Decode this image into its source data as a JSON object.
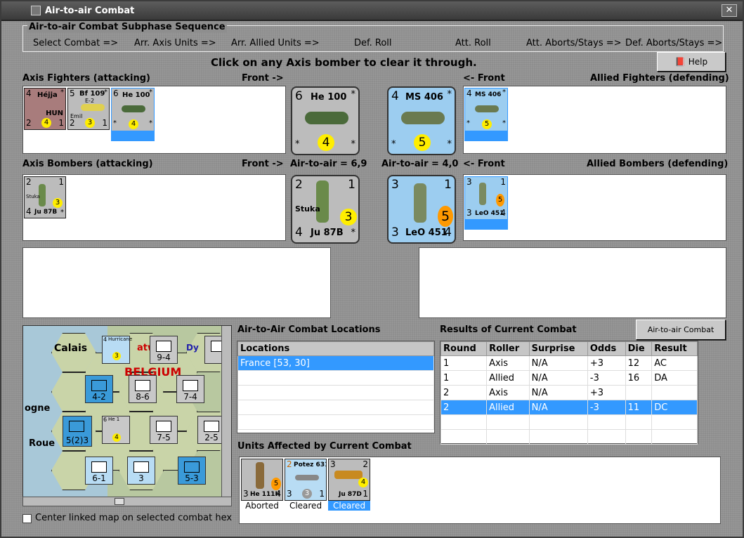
{
  "window": {
    "title": "Air-to-air Combat"
  },
  "sequence": {
    "legend": "Air-to-air Combat Subphase Sequence",
    "steps": [
      "Select Combat =>",
      "Arr. Axis Units =>",
      "Arr. Allied Units =>",
      "Def. Roll",
      "Att. Roll",
      "Att. Aborts/Stays =>",
      "Def. Aborts/Stays =>"
    ]
  },
  "instruction": "Click on any Axis bomber to clear it through.",
  "help_button": "Help",
  "labels": {
    "axis_fighters": "Axis Fighters (attacking)",
    "front_right": "Front ->",
    "front_left": "<- Front",
    "allied_fighters": "Allied Fighters (defending)",
    "axis_bombers": "Axis Bombers (attacking)",
    "air_axis": "Air-to-air = 6,9",
    "air_allied": "Air-to-air = 4,0",
    "allied_bombers": "Allied Bombers (defending)"
  },
  "axis_fighters": [
    {
      "tl": "4",
      "nm": "Héjja",
      "sub": "HUN",
      "bl": "2",
      "die": "4",
      "br": "1",
      "tr": "*",
      "color": "#a87c7c"
    },
    {
      "tl": "5",
      "nm": "Bf 109",
      "sub": "E-2",
      "note": "Emil",
      "bl": "2",
      "die": "3",
      "br": "1",
      "tr": "*",
      "color": "#bcbcbc"
    },
    {
      "tl": "6",
      "nm": "He 100",
      "bl": "*",
      "die": "4",
      "br": "*",
      "tr": "*",
      "color": "#bcbcbc"
    }
  ],
  "front_axis_fighter": {
    "tl": "6",
    "nm": "He 100",
    "tr": "*",
    "bl": "*",
    "die": "4",
    "br": "*"
  },
  "front_allied_fighter": {
    "tl": "4",
    "nm": "MS 406",
    "tr": "*",
    "bl": "*",
    "die": "5",
    "br": "*"
  },
  "allied_fighters": [
    {
      "tl": "4",
      "nm": "MS 406",
      "tr": "*",
      "bl": "*",
      "die": "5",
      "br": "*"
    }
  ],
  "axis_bombers": [
    {
      "tl": "2",
      "tr": "1",
      "note": "Stuka",
      "die": "3",
      "bl": "4",
      "nm": "Ju 87B",
      "br": "*"
    }
  ],
  "front_axis_bomber": {
    "tl": "2",
    "tr": "1",
    "note": "Stuka",
    "die": "3",
    "bl": "4",
    "nm": "Ju 87B",
    "br": "*"
  },
  "front_allied_bomber": {
    "tl": "3",
    "tr": "1",
    "die": "5",
    "bl": "3",
    "nm": "LeO 451",
    "br": "4"
  },
  "allied_bombers": [
    {
      "tl": "3",
      "tr": "1",
      "die": "5",
      "bl": "3",
      "nm": "LeO 451",
      "br": "4"
    }
  ],
  "locations": {
    "title": "Air-to-Air Combat Locations",
    "header": "Locations",
    "rows": [
      "France [53, 30]",
      "",
      "",
      "",
      "",
      ""
    ]
  },
  "results": {
    "title": "Results of Current Combat",
    "chart_button": "Air-to-air Combat Chart",
    "headers": [
      "Round",
      "Roller",
      "Surprise",
      "Odds",
      "Die",
      "Result"
    ],
    "rows": [
      [
        "1",
        "Axis",
        "N/A",
        "+3",
        "12",
        "AC"
      ],
      [
        "1",
        "Allied",
        "N/A",
        "-3",
        "16",
        "DA"
      ],
      [
        "2",
        "Axis",
        "N/A",
        "+3",
        "",
        ""
      ],
      [
        "2",
        "Allied",
        "N/A",
        "-3",
        "11",
        "DC"
      ],
      [
        "",
        "",
        "",
        "",
        "",
        ""
      ],
      [
        "",
        "",
        "",
        "",
        "",
        ""
      ]
    ]
  },
  "affected": {
    "title": "Units Affected by Current Combat",
    "units": [
      {
        "tl": "3",
        "tr": "",
        "nm": "He 111H",
        "br": "4",
        "die": "5",
        "status": "Aborted"
      },
      {
        "tl": "2",
        "nm": "Potez 631",
        "bl": "3",
        "die": "3",
        "br": "1",
        "status": "Cleared"
      },
      {
        "tl": "3",
        "tr": "2",
        "nm": "Ju 87D",
        "br": "1",
        "die": "4",
        "status": "Cleared"
      }
    ]
  },
  "map": {
    "place1": "Calais",
    "place2": "ogne",
    "place3": "Roue",
    "place4": "atw",
    "place5": "Dy",
    "place6": "BELGIUM",
    "counters": [
      {
        "v": "9-4",
        "lab": "xxx",
        "c": "#c8c8c8"
      },
      {
        "v": "4-2",
        "lab": "xxx",
        "c": "#3a9ad9"
      },
      {
        "v": "8-6",
        "lab": "xxx",
        "c": "#c8c8c8"
      },
      {
        "v": "7-4",
        "lab": "xxx",
        "c": "#c8c8c8"
      },
      {
        "v": "5(2)3",
        "lab": "xxxxx",
        "c": "#3a9ad9"
      },
      {
        "v": "7-5",
        "lab": "xxx",
        "c": "#c8c8c8"
      },
      {
        "v": "2-5",
        "lab": "xx",
        "c": "#c8c8c8"
      },
      {
        "v": "6-1",
        "lab": "xxx",
        "c": "#b8dcf4"
      },
      {
        "v": "3",
        "lab": "xx",
        "c": "#b8dcf4"
      },
      {
        "v": "5-3",
        "lab": "xxx",
        "c": "#3a9ad9"
      }
    ],
    "air_counter": {
      "tl": "4",
      "nm": "Hurricane",
      "die": "3"
    },
    "stack": {
      "tl": "6",
      "nm": "He 1",
      "die": "4"
    }
  },
  "center_checkbox": "Center linked map on selected combat hex"
}
